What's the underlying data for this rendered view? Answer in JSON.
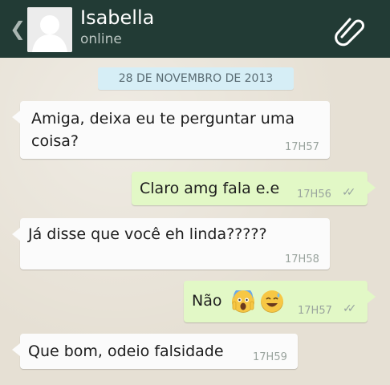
{
  "header": {
    "back_icon": "chevron-left-icon",
    "contact_name": "Isabella",
    "status": "online",
    "attach_icon": "paperclip-icon"
  },
  "date_separator": "28 DE NOVEMBRO DE 2013",
  "messages": [
    {
      "direction": "incoming",
      "lines": [
        "Amiga, deixa eu te perguntar uma",
        "coisa?"
      ],
      "time": "17H57"
    },
    {
      "direction": "outgoing",
      "text": "Claro amg fala e.e",
      "time": "17H56",
      "status_icon": "double-check-icon"
    },
    {
      "direction": "incoming",
      "text": "Já disse que você eh linda?????",
      "time": "17H58"
    },
    {
      "direction": "outgoing",
      "text": "Não",
      "emojis": [
        "screaming-face-emoji",
        "sweat-smile-emoji"
      ],
      "time": "17H57",
      "status_icon": "double-check-icon"
    },
    {
      "direction": "incoming",
      "text": "Que bom, odeio falsidade",
      "time": "17H59"
    }
  ],
  "colors": {
    "header_bg": "#223b35",
    "incoming_bubble": "#fbfbfb",
    "outgoing_bubble": "#e2f8c6",
    "date_pill": "#d6eef6",
    "chat_bg": "#e6e0d4"
  }
}
